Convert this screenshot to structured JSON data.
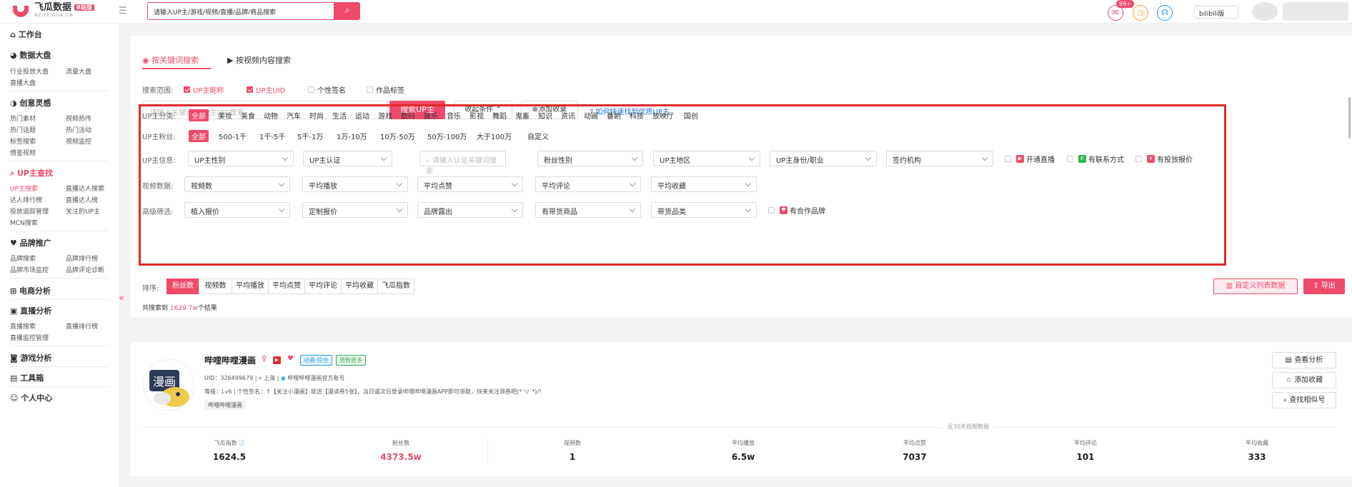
{
  "brand": {
    "name": "飞瓜数据",
    "sub": "BZ.FEIGUA.CN",
    "badge": "B站版"
  },
  "top": {
    "search_placeholder": "请输入UP主/游戏/视频/直播/品牌/商品搜索",
    "msg_badge": "99+",
    "platform": "bilibili版"
  },
  "sidebar": {
    "workbench": "工作台",
    "dashboard": {
      "title": "数据大盘",
      "items": [
        "行业投放大盘",
        "流量大盘",
        "直播大盘"
      ]
    },
    "creative": {
      "title": "创意灵感",
      "items": [
        "热门素材",
        "视频热传",
        "热门话题",
        "热门活动",
        "标签搜索",
        "视频监控",
        "借鉴视频"
      ]
    },
    "up": {
      "title": "UP主查找",
      "items": [
        "UP主搜索",
        "直播达人搜索",
        "达人排行榜",
        "直播达人榜",
        "投放追踪管理",
        "关注的UP主",
        "MCN搜索"
      ]
    },
    "brand": {
      "title": "品牌推广",
      "items": [
        "品牌搜索",
        "品牌排行榜",
        "品牌市场监控",
        "品牌评论诊断"
      ]
    },
    "ecommerce": {
      "title": "电商分析"
    },
    "live": {
      "title": "直播分析",
      "items": [
        "直播搜索",
        "直播排行榜",
        "直播监控管理"
      ]
    },
    "game": {
      "title": "游戏分析"
    },
    "tools": {
      "title": "工具箱"
    },
    "personal": {
      "title": "个人中心"
    }
  },
  "tabs": [
    "按关键词搜索",
    "按视频内容搜索"
  ],
  "scope": {
    "label": "搜索范围:",
    "options": [
      {
        "label": "UP主昵称",
        "checked": true
      },
      {
        "label": "UP主UID",
        "checked": true
      },
      {
        "label": "个性签名",
        "checked": false
      },
      {
        "label": "作品标签",
        "checked": false
      }
    ]
  },
  "search": {
    "placeholder": "请输入关键词或UP主UID搜索",
    "button": "搜索UP主",
    "collapse": "收起条件",
    "add": "添加收录",
    "help": "如何快速找到优质UP主"
  },
  "filters": {
    "category_label": "UP主分类:",
    "categories": [
      "全部",
      "美妆",
      "美食",
      "动物",
      "汽车",
      "时尚",
      "生活",
      "运动",
      "游戏",
      "数码",
      "娱乐",
      "音乐",
      "影视",
      "舞蹈",
      "鬼畜",
      "知识",
      "资讯",
      "动画",
      "番剧",
      "科技",
      "放映厅",
      "国创"
    ],
    "fans_label": "UP主粉丝:",
    "fans": [
      "全部",
      "500-1千",
      "1千-5千",
      "5千-1万",
      "1万-10万",
      "10万-50万",
      "50万-100万",
      "大于100万",
      "自定义"
    ],
    "info_label": "UP主信息:",
    "info": [
      "UP主性别",
      "UP主认证",
      "请输入认证关键词搜索",
      "粉丝性别",
      "UP主地区",
      "UP主身份/职业",
      "签约机构"
    ],
    "info_checks": [
      "开通直播",
      "有联系方式",
      "有投放报价"
    ],
    "video_label": "视频数据:",
    "video": [
      "视频数",
      "平均播放",
      "平均点赞",
      "平均评论",
      "平均收藏"
    ],
    "adv_label": "高级筛选:",
    "adv": [
      "植入报价",
      "定制报价",
      "品牌露出",
      "有带货商品",
      "带货品类"
    ],
    "adv_check": "有合作品牌"
  },
  "sort": {
    "label": "排序:",
    "tabs": [
      "粉丝数",
      "视频数",
      "平均播放",
      "平均点赞",
      "平均评论",
      "平均收藏",
      "飞瓜指数"
    ],
    "custom": "自定义列表数据",
    "export": "导出"
  },
  "total": {
    "prefix": "共搜索到",
    "value": "1629.7w",
    "suffix": "个结果"
  },
  "result": {
    "name": "哔哩哔哩漫画",
    "tags": [
      "动画·综合",
      "男粉居多"
    ],
    "uid": "UID：326499679",
    "location": "上海",
    "verified": "哔哩哔哩漫画官方账号",
    "bio": "等级：Lv6 | 个性签名：↑【关注小漫画】就送【漫读券5张】，当日或次日登录哔哩哔哩漫画APP即可领取，快来关注领券吧(*´▽`*)/！",
    "topic_tag": "哔哩哔哩漫画",
    "actions": [
      "查看分析",
      "添加收藏",
      "查找相似号"
    ],
    "divider": "近30天视频数据",
    "stats": [
      {
        "label": "飞瓜指数",
        "value": "1624.5"
      },
      {
        "label": "粉丝数",
        "value": "4373.5w"
      },
      {
        "label": "视频数",
        "value": "1"
      },
      {
        "label": "平均播放",
        "value": "6.5w"
      },
      {
        "label": "平均点赞",
        "value": "7037"
      },
      {
        "label": "平均评论",
        "value": "101"
      },
      {
        "label": "平均收藏",
        "value": "333"
      }
    ]
  },
  "colors": {
    "accent": "#ef4a6a",
    "highlight": "#e02a2a",
    "link": "#1e6fd9"
  }
}
